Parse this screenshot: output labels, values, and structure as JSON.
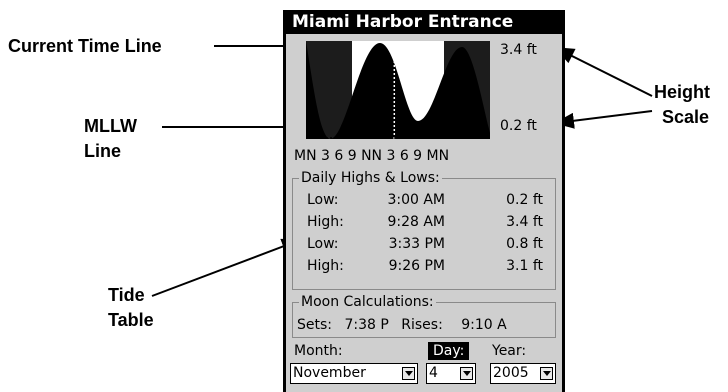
{
  "annotations": {
    "current_time_line": "Current Time Line",
    "mllw_line": [
      "MLLW",
      "Line"
    ],
    "height_scale": [
      "Height",
      "Scale"
    ],
    "tide_table": [
      "Tide",
      "Table"
    ]
  },
  "screen": {
    "title": "Miami Harbor Entrance",
    "scale_top": "3.4 ft",
    "scale_bottom": "0.2 ft",
    "time_axis": "MN 3 6 9 NN 3 6 9 MN",
    "current_time_fraction": 0.48,
    "daily": {
      "legend": "Daily Highs & Lows:",
      "rows": [
        {
          "type": "Low:",
          "time": "3:00 AM",
          "height": "0.2 ft"
        },
        {
          "type": "High:",
          "time": "9:28 AM",
          "height": "3.4 ft"
        },
        {
          "type": "Low:",
          "time": "3:33 PM",
          "height": "0.8 ft"
        },
        {
          "type": "High:",
          "time": "9:26 PM",
          "height": "3.1 ft"
        }
      ]
    },
    "moon": {
      "legend": "Moon Calculations:",
      "sets_label": "Sets:",
      "sets_value": "7:38 P",
      "rises_label": "Rises:",
      "rises_value": "9:10 A"
    },
    "month_label": "Month:",
    "day_label": "Day:",
    "year_label": "Year:",
    "month_value": "November",
    "day_value": "4",
    "year_value": "2005"
  },
  "colors": {
    "screen_bg": "#cfcfcf",
    "title_bg": "#000000",
    "graph_fill": "#000000",
    "night_fill": "#1c1c1c"
  }
}
